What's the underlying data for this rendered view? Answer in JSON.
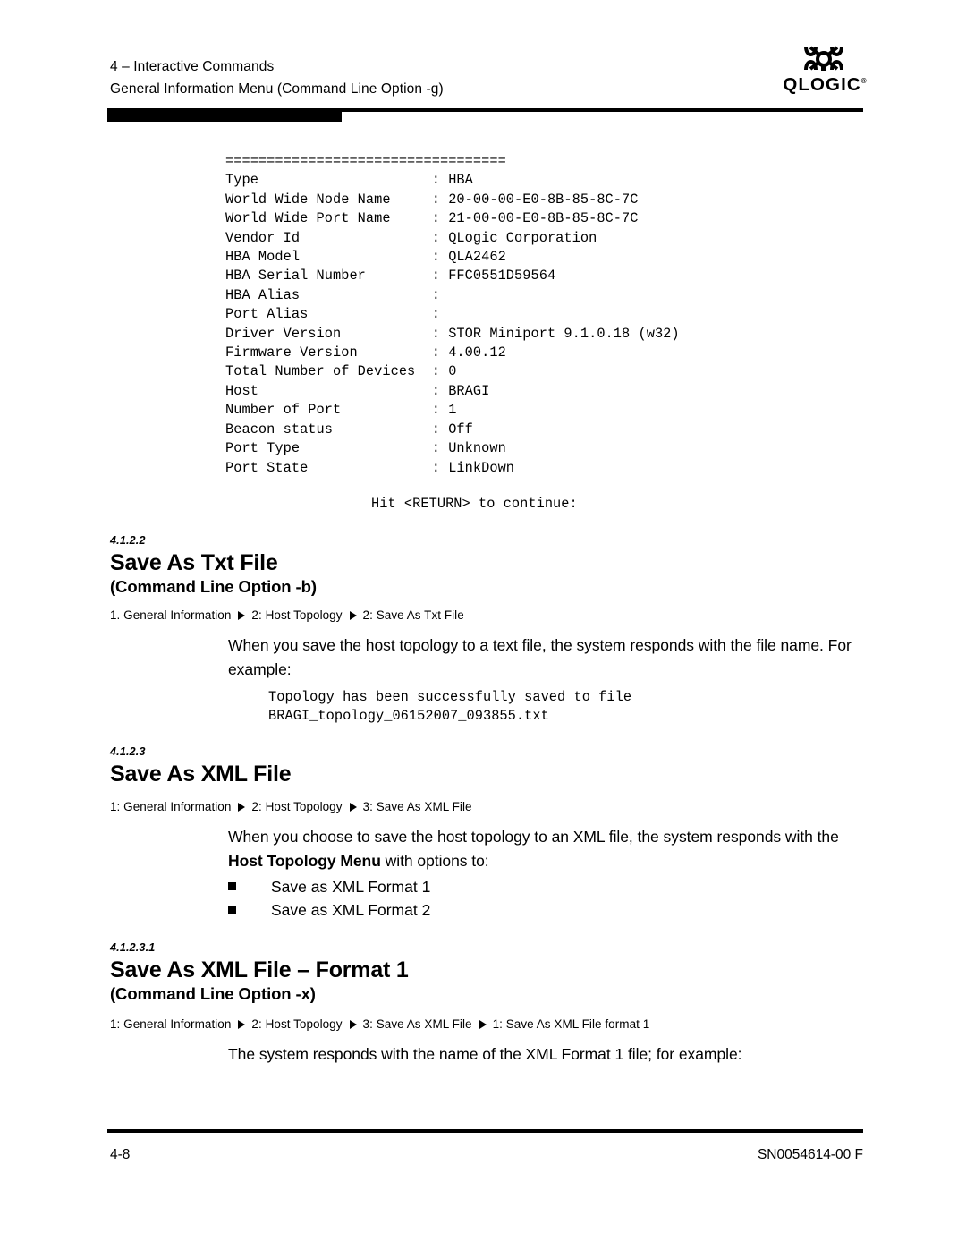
{
  "header": {
    "line1": "4 – Interactive Commands",
    "line2": "General Information Menu (Command Line Option -g)",
    "logo_wordmark": "QLOGIC",
    "logo_registered": "®",
    "logo_mark_name": "qlogic-symbol"
  },
  "terminal": {
    "lines": [
      "==================================",
      "Type                     : HBA",
      "World Wide Node Name     : 20-00-00-E0-8B-85-8C-7C",
      "World Wide Port Name     : 21-00-00-E0-8B-85-8C-7C",
      "Vendor Id                : QLogic Corporation",
      "HBA Model                : QLA2462",
      "HBA Serial Number        : FFC0551D59564",
      "HBA Alias                :",
      "Port Alias               :",
      "Driver Version           : STOR Miniport 9.1.0.18 (w32)",
      "Firmware Version         : 4.00.12",
      "Total Number of Devices  : 0",
      "Host                     : BRAGI",
      "Number of Port           : 1",
      "Beacon status            : Off",
      "Port Type                : Unknown",
      "Port State               : LinkDown"
    ],
    "hit_return": "Hit <RETURN> to continue:"
  },
  "sections": [
    {
      "number": "4.1.2.2",
      "title": "Save As Txt File",
      "subtitle": "(Command Line Option -b)",
      "breadcrumb": [
        "1. General Information",
        "2: Host Topology",
        "2: Save As Txt File"
      ],
      "paragraph": "When you save the host topology to a text file, the system responds with the file name. For example:",
      "code": [
        "Topology has been successfully saved to file",
        "BRAGI_topology_06152007_093855.txt"
      ]
    },
    {
      "number": "4.1.2.3",
      "title": "Save As XML File",
      "subtitle": "",
      "breadcrumb": [
        "1: General Information",
        "2: Host Topology",
        "3: Save As XML File"
      ],
      "paragraph_part1": "When you choose to save the host topology to an XML file, the system responds with the ",
      "paragraph_bold": "Host Topology Menu",
      "paragraph_part2": " with options to:",
      "bullets": [
        "Save as XML Format 1",
        "Save as XML Format 2"
      ]
    },
    {
      "number": "4.1.2.3.1",
      "title": "Save As XML File – Format 1",
      "subtitle": "(Command Line Option -x)",
      "breadcrumb": [
        "1: General Information",
        "2: Host Topology",
        "3: Save As XML File",
        "1: Save As XML File format 1"
      ],
      "paragraph": "The system responds with the name of the XML Format 1 file; for example:"
    }
  ],
  "footer": {
    "page_number": "4-8",
    "document_id": "SN0054614-00  F"
  }
}
